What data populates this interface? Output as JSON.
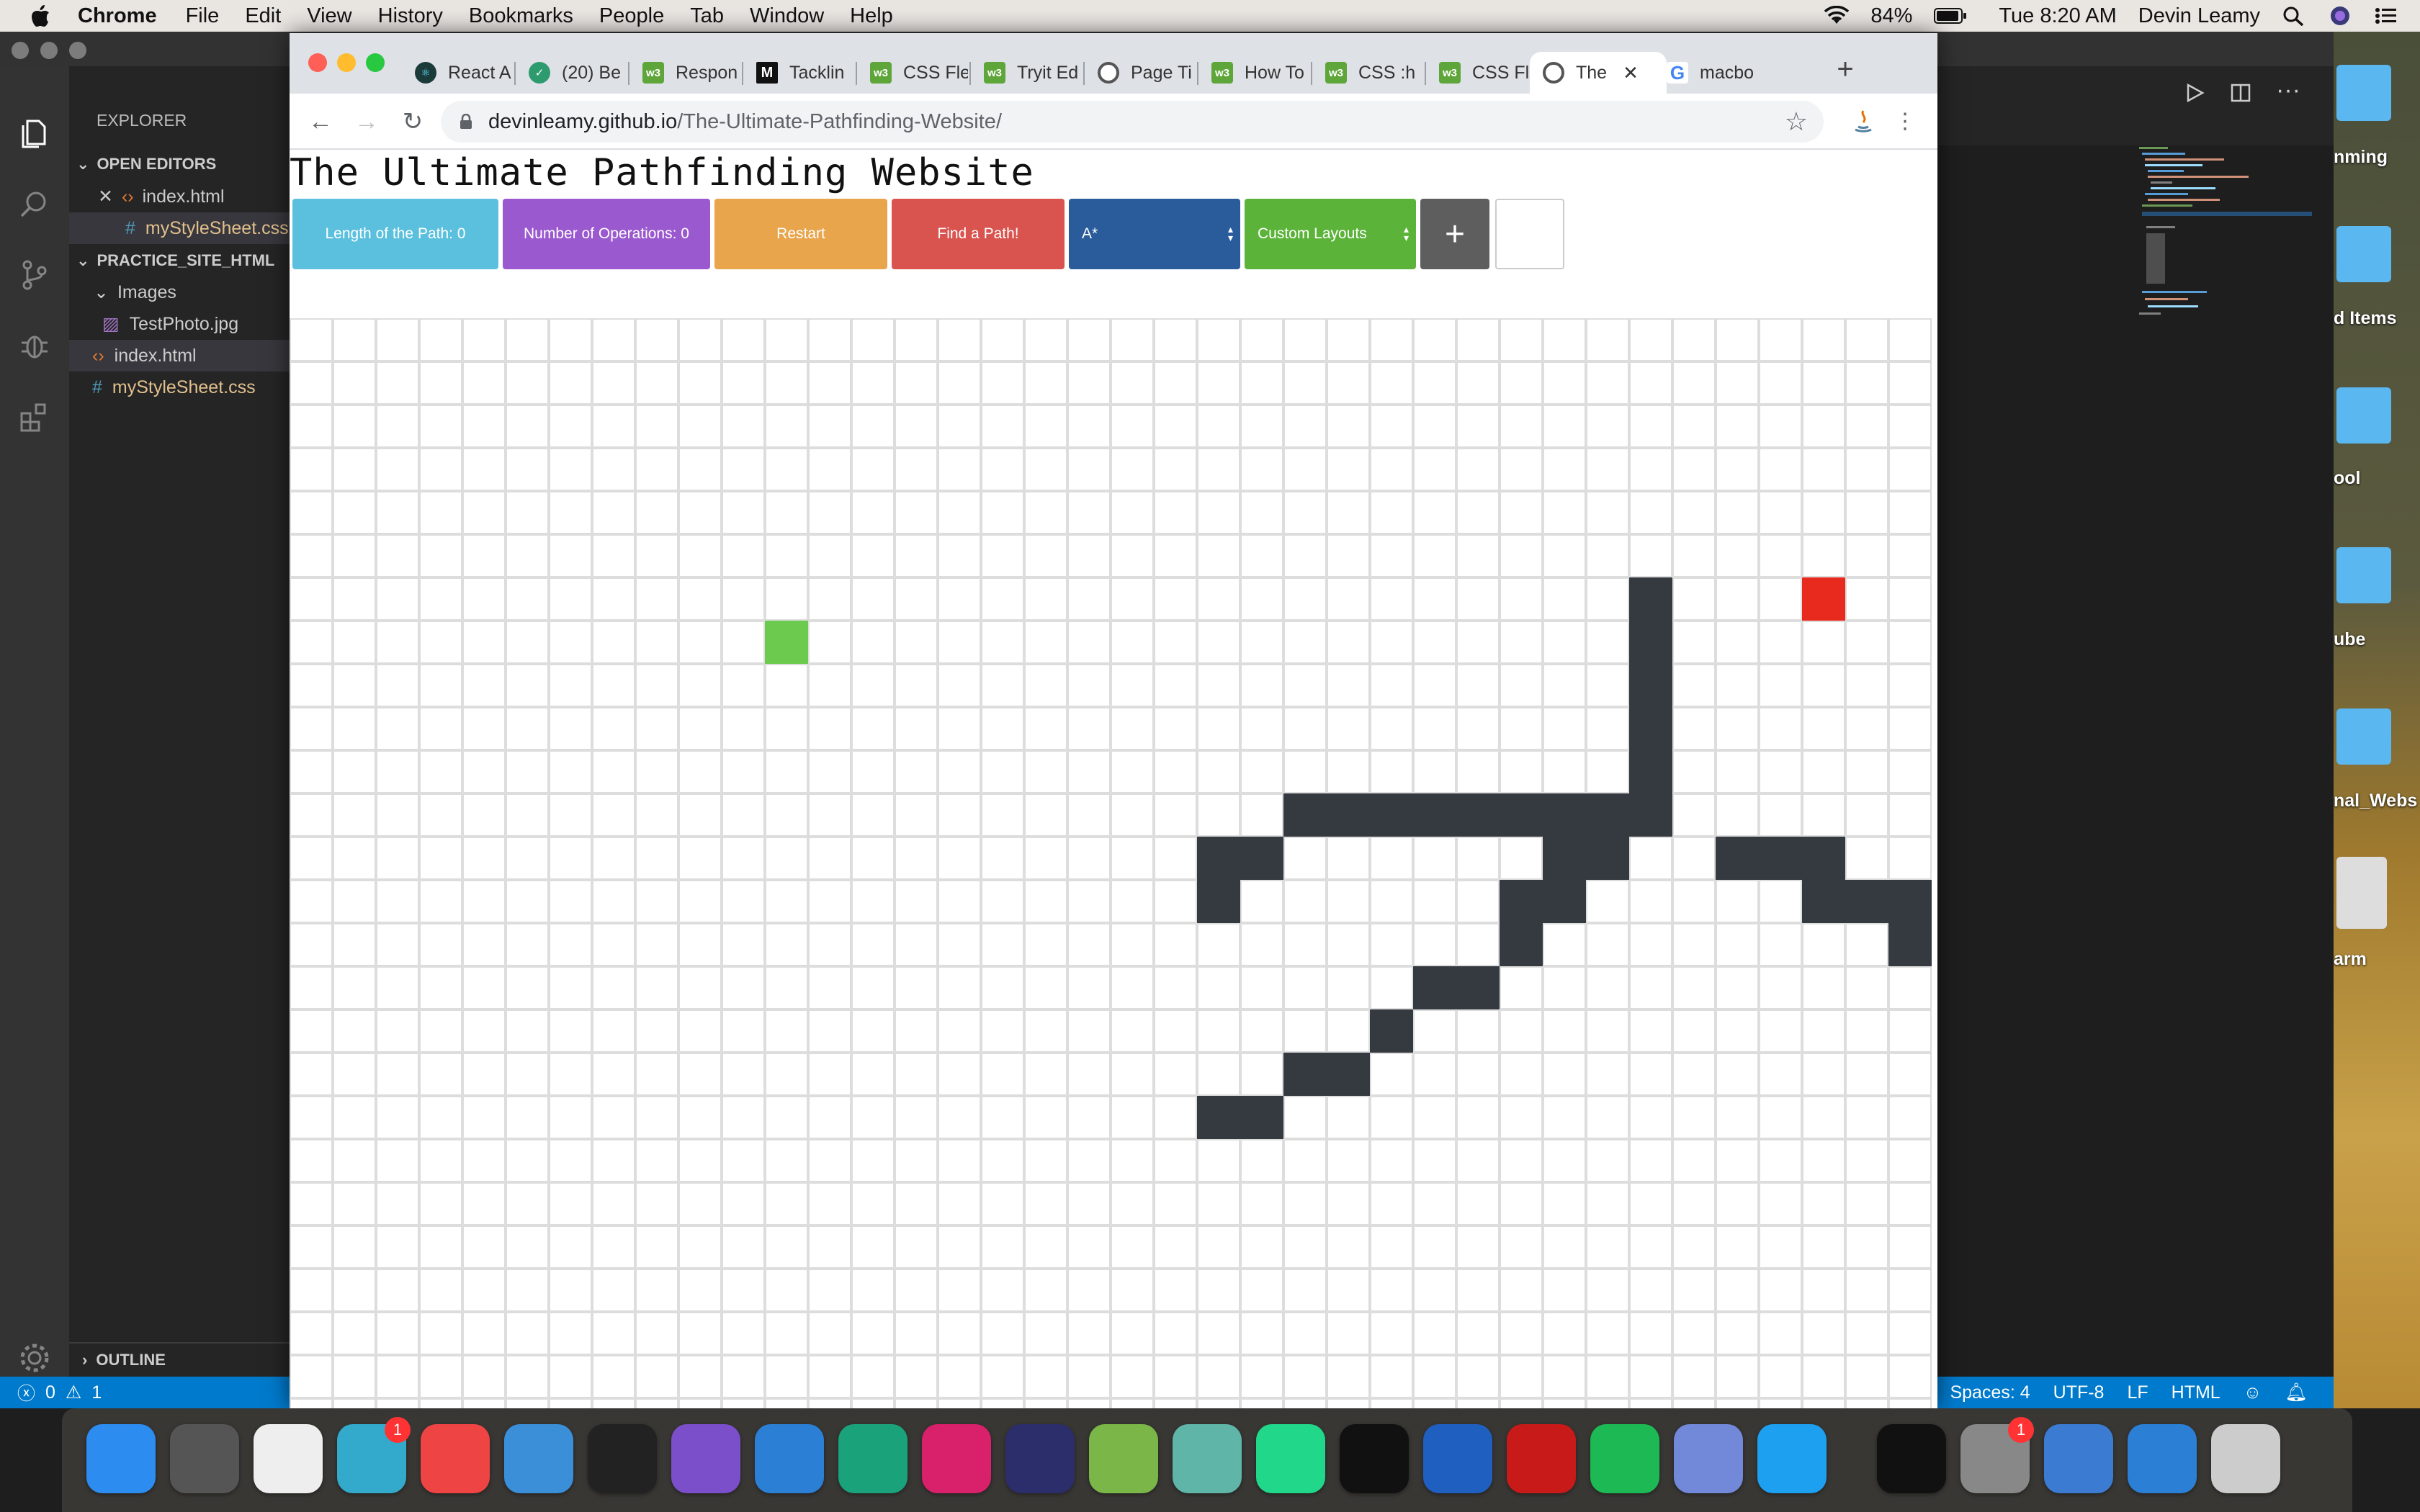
{
  "menubar": {
    "app": "Chrome",
    "items": [
      "File",
      "Edit",
      "View",
      "History",
      "Bookmarks",
      "People",
      "Tab",
      "Window",
      "Help"
    ],
    "battery": "84%",
    "clock": "Tue 8:20 AM",
    "user": "Devin Leamy"
  },
  "vscode": {
    "explorer_title": "EXPLORER",
    "open_editors": "OPEN EDITORS",
    "open_files": [
      "index.html",
      "myStyleSheet.css"
    ],
    "project": "PRACTICE_SITE_HTML",
    "tree": {
      "folder": "Images",
      "image": "TestPhoto.jpg",
      "html": "index.html",
      "css": "myStyleSheet.css"
    },
    "outline": "OUTLINE",
    "status_left": {
      "errors": "0",
      "warnings": "1"
    },
    "status_right": [
      "Spaces: 4",
      "UTF-8",
      "LF",
      "HTML"
    ]
  },
  "desktop": {
    "labels": [
      "nming",
      "d Items",
      "ool",
      "ube",
      "nal_Webs",
      "arm"
    ]
  },
  "chrome": {
    "tabs": [
      {
        "title": "React A",
        "fav": "react",
        "fav_text": "⚛"
      },
      {
        "title": "(20) Be",
        "fav": "shield",
        "fav_text": "✓"
      },
      {
        "title": "Respon",
        "fav": "w3",
        "fav_text": "w3"
      },
      {
        "title": "Tacklin",
        "fav": "medium",
        "fav_text": "M"
      },
      {
        "title": "CSS Fle",
        "fav": "w3",
        "fav_text": "w3"
      },
      {
        "title": "Tryit Ed",
        "fav": "w3",
        "fav_text": "w3"
      },
      {
        "title": "Page Ti",
        "fav": "globe",
        "fav_text": ""
      },
      {
        "title": "How To",
        "fav": "w3",
        "fav_text": "w3"
      },
      {
        "title": "CSS :h",
        "fav": "w3",
        "fav_text": "w3"
      },
      {
        "title": "CSS Fle",
        "fav": "w3",
        "fav_text": "w3"
      },
      {
        "title": "The",
        "fav": "globe",
        "fav_text": ""
      },
      {
        "title": "macbo",
        "fav": "google",
        "fav_text": "G"
      }
    ],
    "url_host": "devinleamy.github.io",
    "url_path": "/The-Ultimate-Pathfinding-Website/"
  },
  "page": {
    "title": "The Ultimate Pathfinding Website",
    "length_label": "Length of the Path: 0",
    "ops_label": "Number of Operations: 0",
    "restart_label": "Restart",
    "find_label": "Find a Path!",
    "algorithm": "A*",
    "layouts": "Custom Layouts",
    "add_label": "+",
    "colors": {
      "length": "#5bc0de",
      "ops": "#9b59d0",
      "restart": "#e8a54b",
      "find": "#d9534f",
      "algorithm": "#2a5b9a",
      "layouts": "#5cb33a",
      "add": "#5e5e5e",
      "wall": "#343a40",
      "start": "#6ccb4f",
      "end": "#e8291e",
      "grid_line": "#dddddd"
    }
  },
  "grid": {
    "cols": 38,
    "rows": 26,
    "start": [
      11,
      7
    ],
    "end": [
      35,
      6
    ],
    "walls": [
      [
        31,
        6
      ],
      [
        31,
        7
      ],
      [
        31,
        8
      ],
      [
        31,
        9
      ],
      [
        31,
        10
      ],
      [
        31,
        11
      ],
      [
        23,
        11
      ],
      [
        24,
        11
      ],
      [
        25,
        11
      ],
      [
        26,
        11
      ],
      [
        27,
        11
      ],
      [
        28,
        11
      ],
      [
        29,
        11
      ],
      [
        30,
        11
      ],
      [
        21,
        12
      ],
      [
        22,
        12
      ],
      [
        29,
        12
      ],
      [
        30,
        12
      ],
      [
        21,
        13
      ],
      [
        28,
        13
      ],
      [
        29,
        13
      ],
      [
        28,
        14
      ],
      [
        26,
        15
      ],
      [
        27,
        15
      ],
      [
        25,
        16
      ],
      [
        23,
        17
      ],
      [
        24,
        17
      ],
      [
        21,
        18
      ],
      [
        22,
        18
      ],
      [
        33,
        12
      ],
      [
        34,
        12
      ],
      [
        35,
        12
      ],
      [
        35,
        13
      ],
      [
        36,
        13
      ],
      [
        37,
        13
      ],
      [
        37,
        14
      ]
    ]
  },
  "dock": {
    "apps": [
      "Finder",
      "Launchpad",
      "TextEdit",
      "Messages",
      "Chrome",
      "Xcode",
      "Unity",
      "Visual Studio",
      "VS Code",
      "CLion",
      "IntelliJ IDEA",
      "Eclipse",
      "Android Studio",
      "Atom",
      "PyCharm",
      "Terminal",
      "Xcode Instruments",
      "PokerStars",
      "Spotify",
      "Discord",
      "Safari",
      "Terminal",
      "System Preferences",
      "Preview",
      "VS Code",
      "Trash"
    ],
    "badges": {
      "Messages": "1",
      "System Preferences": "1"
    }
  }
}
